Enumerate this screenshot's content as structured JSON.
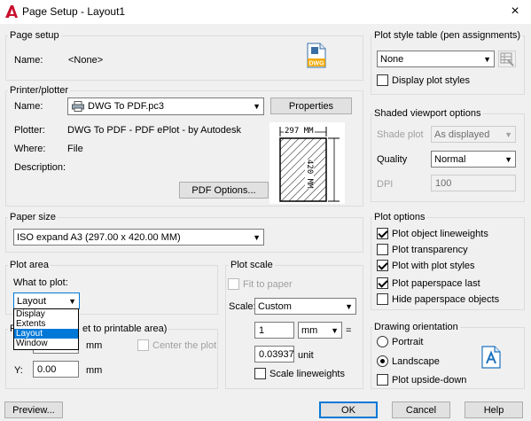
{
  "window": {
    "title": "Page Setup - Layout1",
    "close_glyph": "×"
  },
  "page_setup": {
    "group_label": "Page setup",
    "name_label": "Name:",
    "name_value": "<None>",
    "dwg_badge": "DWG"
  },
  "printer": {
    "group_label": "Printer/plotter",
    "name_label": "Name:",
    "name_value": "DWG To PDF.pc3",
    "properties_button": "Properties",
    "plotter_label": "Plotter:",
    "plotter_value": "DWG To PDF - PDF ePlot - by Autodesk",
    "where_label": "Where:",
    "where_value": "File",
    "description_label": "Description:",
    "pdf_options_button": "PDF Options...",
    "preview_width": "297 MM",
    "preview_height": "420 MM"
  },
  "paper_size": {
    "group_label": "Paper size",
    "value": "ISO expand A3 (297.00 x 420.00 MM)"
  },
  "plot_area": {
    "group_label": "Plot area",
    "what_label": "What to plot:",
    "selected": "Layout",
    "options": [
      "Display",
      "Extents",
      "Layout",
      "Window"
    ]
  },
  "plot_offset": {
    "group_label_visible": "et to printable area)",
    "x_unit": "mm",
    "center_label": "Center the plot",
    "y_label": "Y:",
    "y_value": "0.00",
    "y_unit": "mm"
  },
  "plot_scale": {
    "group_label": "Plot scale",
    "fit_label": "Fit to paper",
    "scale_label": "Scale:",
    "scale_value": "Custom",
    "num_value": "1",
    "num_unit": "mm",
    "equals": "=",
    "den_value": "0.03937",
    "den_unit": "unit",
    "scale_lw_label": "Scale lineweights"
  },
  "plot_style": {
    "group_label": "Plot style table (pen assignments)",
    "value": "None",
    "display_label": "Display plot styles"
  },
  "shaded": {
    "group_label": "Shaded viewport options",
    "shade_label": "Shade plot",
    "shade_value": "As displayed",
    "quality_label": "Quality",
    "quality_value": "Normal",
    "dpi_label": "DPI",
    "dpi_value": "100"
  },
  "plot_options": {
    "group_label": "Plot options",
    "items": [
      {
        "label": "Plot object lineweights",
        "checked": true
      },
      {
        "label": "Plot transparency",
        "checked": false
      },
      {
        "label": "Plot with plot styles",
        "checked": true
      },
      {
        "label": "Plot paperspace last",
        "checked": true
      },
      {
        "label": "Hide paperspace objects",
        "checked": false
      }
    ]
  },
  "orientation": {
    "group_label": "Drawing orientation",
    "portrait": "Portrait",
    "landscape": "Landscape",
    "upside_down": "Plot upside-down",
    "selected": "landscape"
  },
  "footer": {
    "preview_button": "Preview...",
    "ok_button": "OK",
    "cancel_button": "Cancel",
    "help_button": "Help"
  },
  "colors": {
    "accent": "#0078d7",
    "dialog_bg": "#f0f0f0",
    "logo_red": "#c8102e"
  }
}
